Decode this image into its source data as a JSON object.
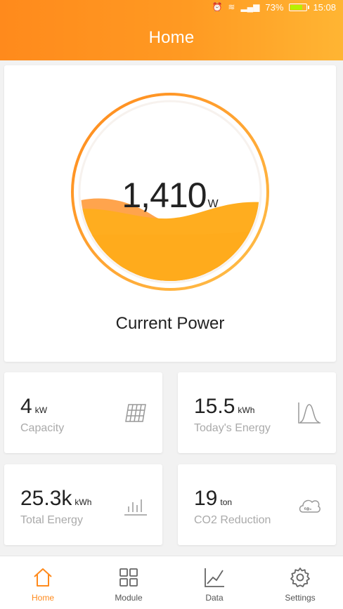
{
  "status_bar": {
    "battery": "73%",
    "time": "15:08"
  },
  "header": {
    "title": "Home"
  },
  "gauge": {
    "value": "1,410",
    "unit": "W",
    "label": "Current Power"
  },
  "stats": {
    "capacity": {
      "value": "4",
      "unit": "kW",
      "label": "Capacity"
    },
    "today_energy": {
      "value": "15.5",
      "unit": "kWh",
      "label": "Today's Energy"
    },
    "total_energy": {
      "value": "25.3k",
      "unit": "kWh",
      "label": "Total Energy"
    },
    "co2": {
      "value": "19",
      "unit": "ton",
      "label": "CO2 Reduction"
    }
  },
  "nav": {
    "home": "Home",
    "module": "Module",
    "data": "Data",
    "settings": "Settings"
  },
  "colors": {
    "accent": "#ff8a1c",
    "wave_primary": "#ffad1f",
    "wave_secondary": "#ff9a3a"
  }
}
